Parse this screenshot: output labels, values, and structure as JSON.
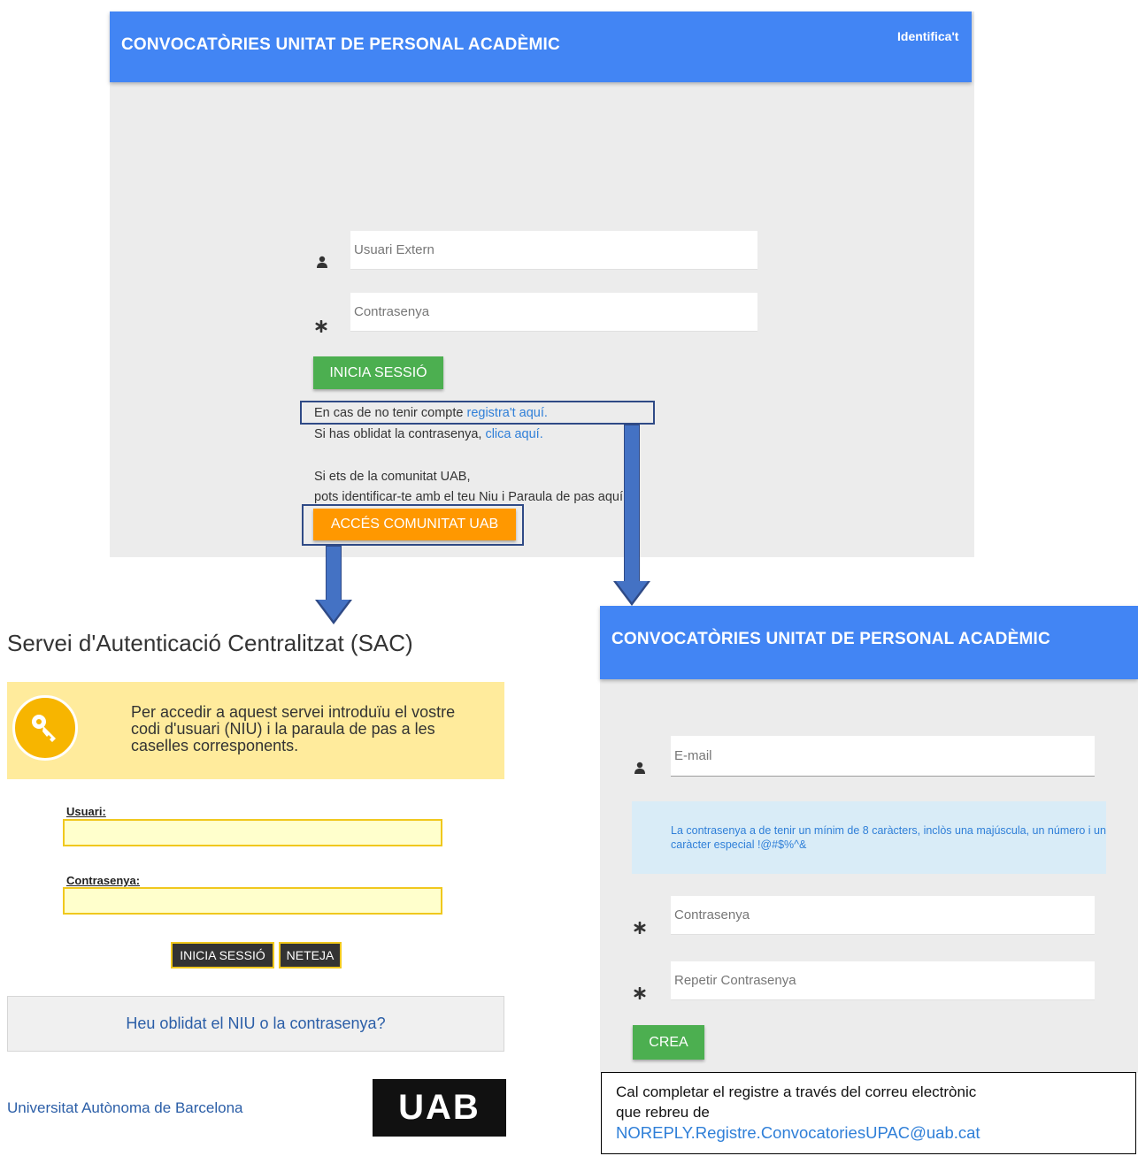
{
  "top_login": {
    "header_title": "CONVOCATÒRIES UNITAT DE PERSONAL ACADÈMIC",
    "header_login": "Identifica't",
    "user_placeholder": "Usuari Extern",
    "password_placeholder": "Contrasenya",
    "login_button": "INICIA SESSIÓ",
    "no_account_text": "En cas de no tenir compte ",
    "register_link": "registra't aquí.",
    "forgot_text": "Si has oblidat la contrasenya, ",
    "forgot_link": "clica aquí.",
    "uab_line1": "Si ets de la comunitat UAB,",
    "uab_line2": "pots identificar-te amb el teu Niu i Paraula de pas aquí:",
    "uab_button": "ACCÉS COMUNITAT UAB"
  },
  "sac": {
    "title": "Servei d'Autenticació Centralitzat (SAC)",
    "info_text": "Per accedir a aquest servei introduïu el vostre codi d'usuari (NIU) i la paraula de pas a les caselles corresponents.",
    "user_label": "Usuari:",
    "password_label": "Contrasenya:",
    "login_button": "INICIA SESSIÓ",
    "clear_button": "NETEJA",
    "forgot_link": "Heu oblidat el NIU o la contrasenya?",
    "university_name": "Universitat Autònoma de Barcelona",
    "logo_text": "UAB"
  },
  "register": {
    "header_title": "CONVOCATÒRIES UNITAT DE PERSONAL ACADÈMIC",
    "email_placeholder": "E-mail",
    "password_rule": "La contrasenya a de tenir un mínim de 8 caràcters, inclòs una majúscula, un número i un caràcter especial !@#$%^&",
    "password_placeholder": "Contrasenya",
    "repeat_placeholder": "Repetir Contrasenya",
    "create_button": "CREA"
  },
  "note": {
    "line1": "Cal completar el registre a través del correu electrònic",
    "line2": "que rebreu de",
    "email": "NOREPLY.Registre.ConvocatoriesUPAC@uab.cat"
  },
  "icons": {
    "user": "user-icon",
    "asterisk": "asterisk-icon",
    "key": "key-icon",
    "arrow": "down-arrow"
  },
  "colors": {
    "header_blue": "#4285f4",
    "button_green": "#4caf50",
    "button_orange": "#ff9800",
    "link_blue": "#2f7fd8",
    "sac_yellow": "#ffeb9c",
    "arrow_blue": "#4472c4"
  }
}
